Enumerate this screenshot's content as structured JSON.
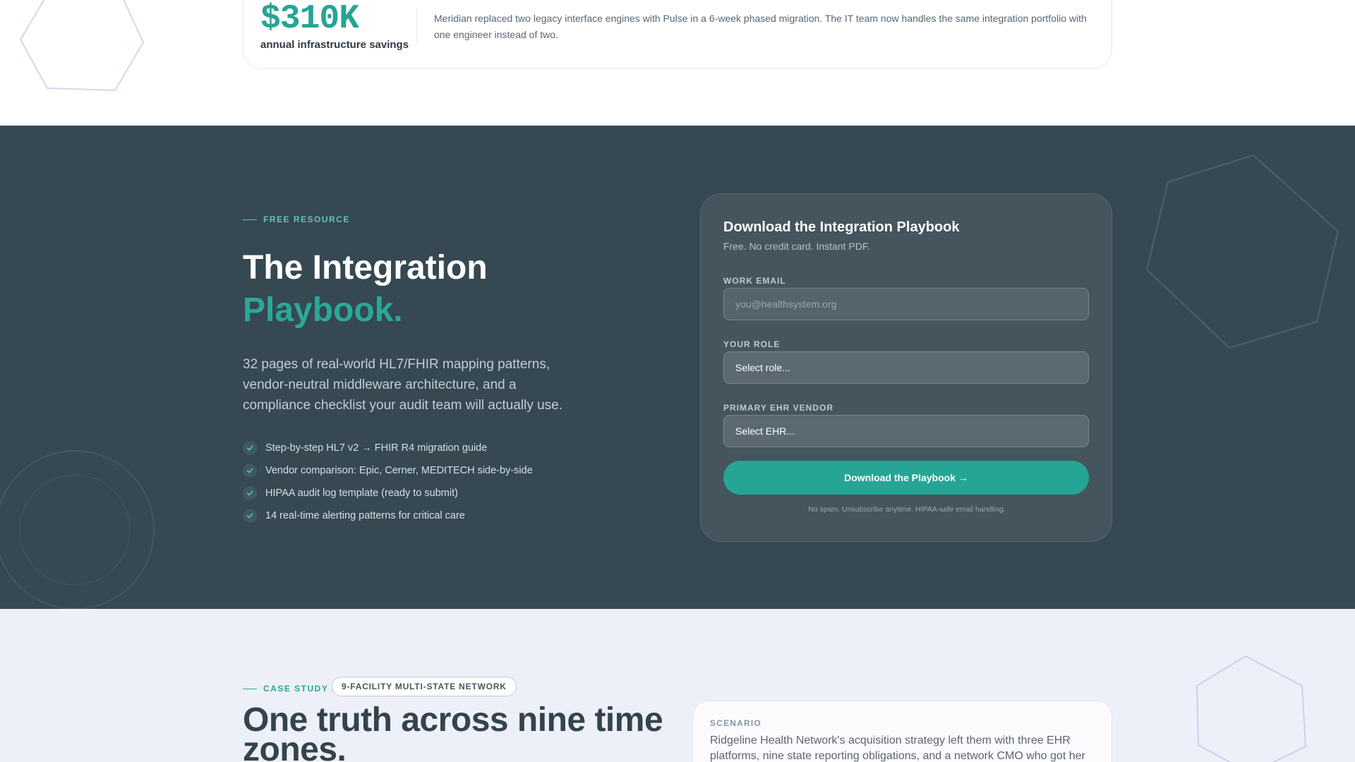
{
  "savings": {
    "amount": "$310K",
    "label": "annual infrastructure savings",
    "description": "Meridian replaced two legacy interface engines with Pulse in a 6-week phased migration. The IT team now handles the same integration portfolio with one engineer instead of two."
  },
  "resource": {
    "eyebrow": "FREE RESOURCE",
    "headline_line1": "The Integration",
    "headline_accent": "Playbook.",
    "lead": "32 pages of real-world HL7/FHIR mapping patterns, vendor-neutral middleware architecture, and a compliance checklist your audit team will actually use.",
    "benefits": [
      "Step-by-step HL7 v2 → FHIR R4 migration guide",
      "Vendor comparison: Epic, Cerner, MEDITECH side-by-side",
      "HIPAA audit log template (ready to submit)",
      "14 real-time alerting patterns for critical care"
    ],
    "icons": {
      "check": "check-icon"
    },
    "colors": {
      "accent": "#26a594",
      "dark_bg": "#364852"
    }
  },
  "form": {
    "title": "Download the Integration Playbook",
    "subtitle": "Free. No credit card. Instant PDF.",
    "email_label": "WORK EMAIL",
    "email_placeholder": "you@healthsystem.org",
    "role_label": "YOUR ROLE",
    "role_value": "Select role...",
    "ehr_label": "PRIMARY EHR VENDOR",
    "ehr_value": "Select EHR...",
    "submit_label": "Download the Playbook →",
    "note": "No spam. Unsubscribe anytime. HIPAA-safe email handling."
  },
  "case_study": {
    "eyebrow": "CASE STUDY 3",
    "badge": "9-FACILITY MULTI-STATE NETWORK",
    "headline": "One truth across nine time zones.",
    "scenario_label": "SCENARIO",
    "scenario_text": "Ridgeline Health Network's acquisition strategy left them with three EHR platforms, nine state reporting obligations, and a network CMO who got her"
  }
}
